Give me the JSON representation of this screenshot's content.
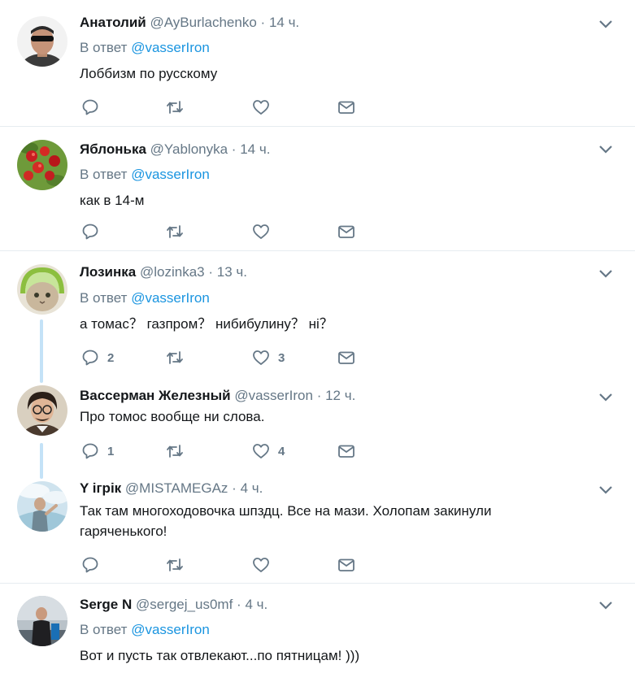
{
  "reply_prefix": "В ответ",
  "colors": {
    "link": "#1b95e0",
    "muted": "#657786",
    "thread_line": "#c4e2f7",
    "divider": "#e6ecf0"
  },
  "tweets": [
    {
      "name": "Анатолий",
      "handle": "@AyBurlachenko",
      "dot": "·",
      "time": "14 ч.",
      "reply_to": "@vasserIron",
      "text": "Лоббизм по русскому",
      "replies": "",
      "likes": ""
    },
    {
      "name": "Яблонька",
      "handle": "@Yablonyka",
      "dot": "·",
      "time": "14 ч.",
      "reply_to": "@vasserIron",
      "text": "как в 14-м",
      "replies": "",
      "likes": ""
    },
    {
      "name": "Лозинка",
      "handle": "@lozinka3",
      "dot": "·",
      "time": "13 ч.",
      "reply_to": "@vasserIron",
      "text": "а томас？ газпром？ нибибулину？ ні？",
      "replies": "2",
      "likes": "3"
    },
    {
      "name": "Вассерман Железный",
      "handle": "@vasserIron",
      "dot": "·",
      "time": "12 ч.",
      "reply_to": "",
      "text": "Про томос вообще ни слова.",
      "replies": "1",
      "likes": "4"
    },
    {
      "name": "Y ігрік",
      "handle": "@MISTAMEGAz",
      "dot": "·",
      "time": "4 ч.",
      "reply_to": "",
      "text": "Так там многоходовочка шпздц. Все на мази. Холопам закинули гаряченького!",
      "replies": "",
      "likes": ""
    },
    {
      "name": "Serge N",
      "handle": "@sergej_us0mf",
      "dot": "·",
      "time": "4 ч.",
      "reply_to": "@vasserIron",
      "text": "Вот и пусть так отвлекают...по пятницам! )))",
      "replies": "",
      "likes": ""
    }
  ]
}
